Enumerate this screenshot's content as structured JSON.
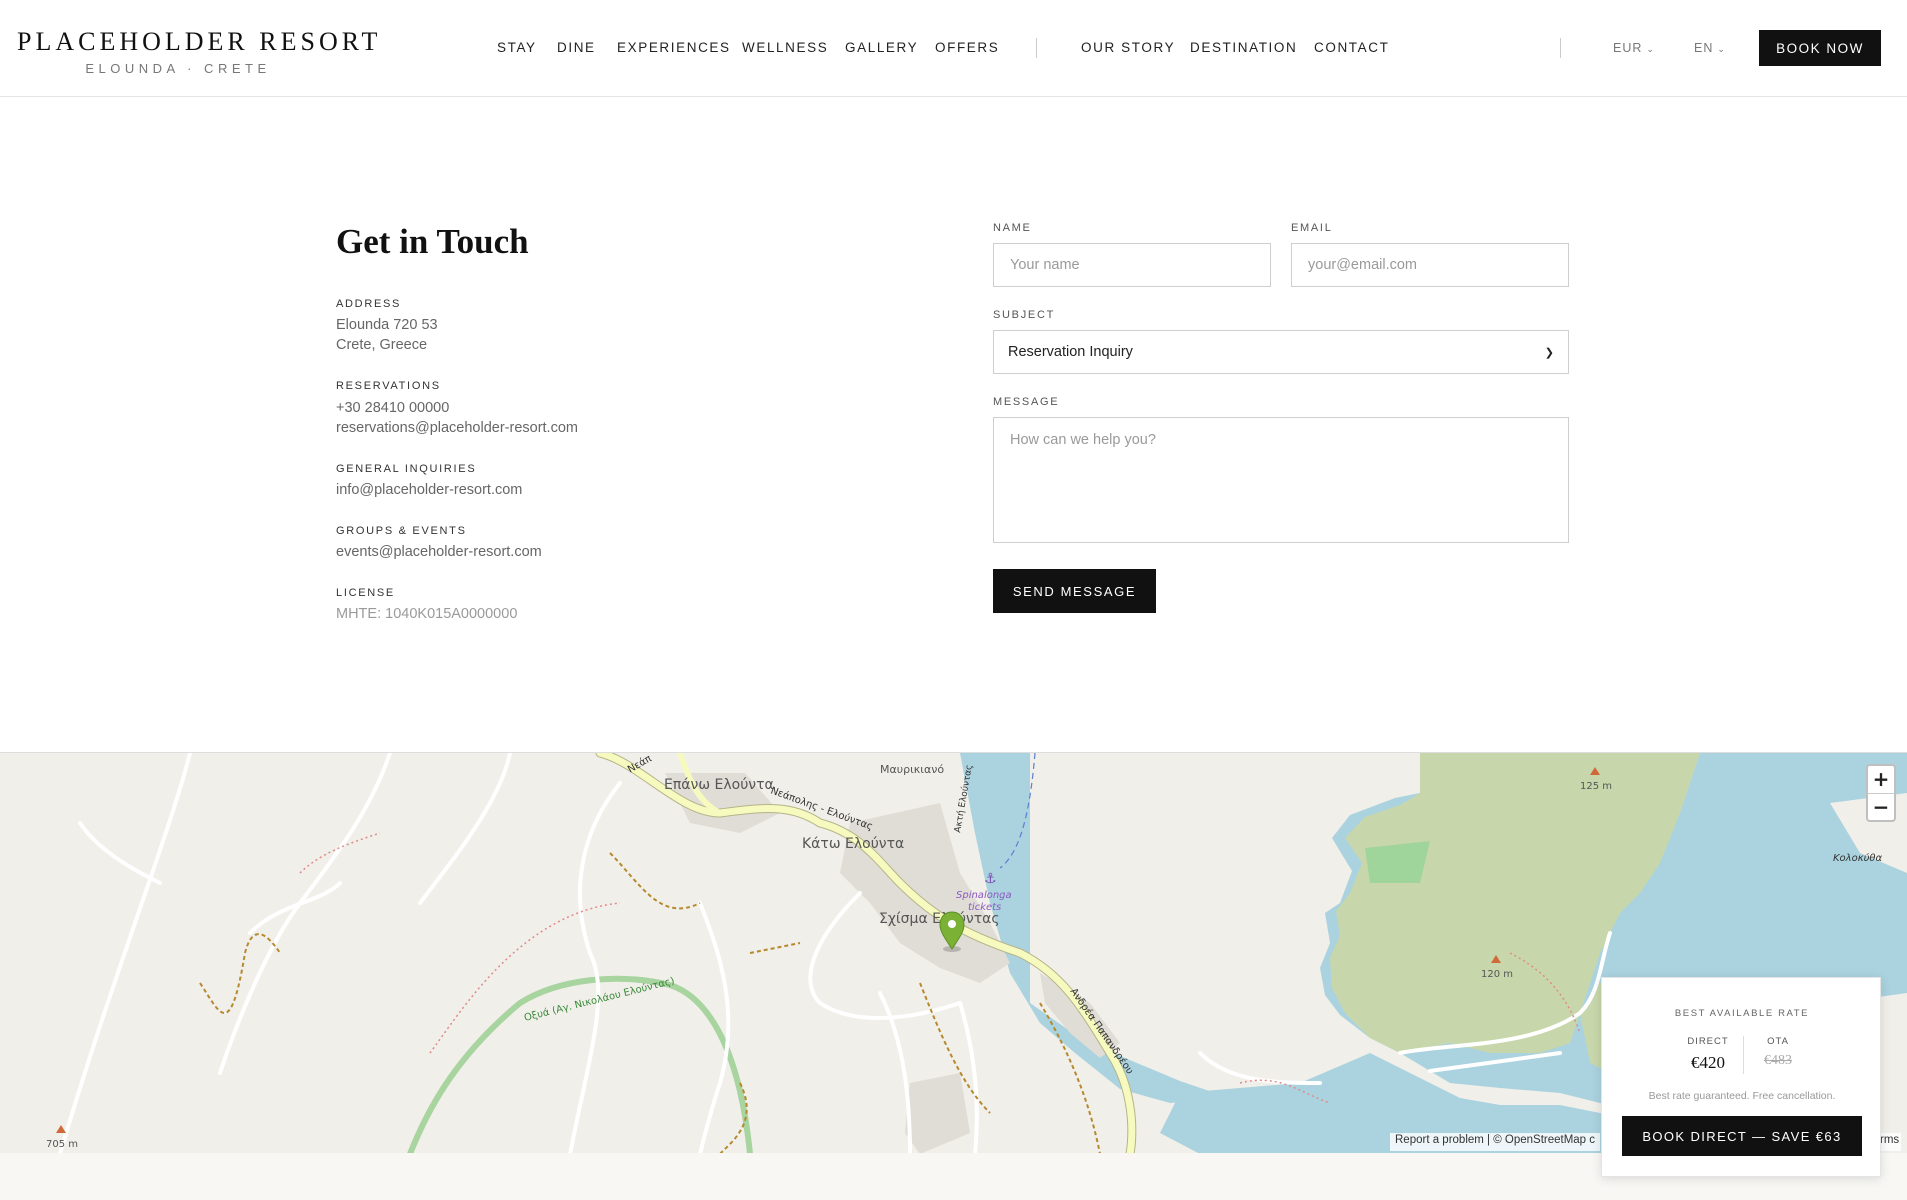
{
  "brand": {
    "name": "PLACEHOLDER RESORT",
    "tagline": "ELOUNDA · CRETE"
  },
  "nav": {
    "primary": [
      "STAY",
      "DINE",
      "EXPERIENCES",
      "WELLNESS",
      "GALLERY",
      "OFFERS"
    ],
    "secondary": [
      "OUR STORY",
      "DESTINATION",
      "CONTACT"
    ],
    "currency": "EUR",
    "language": "EN",
    "book_now": "BOOK NOW"
  },
  "contact": {
    "title": "Get in Touch",
    "address_label": "ADDRESS",
    "address_line1": "Elounda 720 53",
    "address_line2": "Crete, Greece",
    "reservations_label": "RESERVATIONS",
    "reservations_phone": "+30 28410 00000",
    "reservations_email": "reservations@placeholder-resort.com",
    "general_label": "GENERAL INQUIRIES",
    "general_email": "info@placeholder-resort.com",
    "groups_label": "GROUPS & EVENTS",
    "groups_email": "events@placeholder-resort.com",
    "license_label": "LICENSE",
    "license_value": "MHTE: 1040K015A0000000"
  },
  "form": {
    "name_label": "NAME",
    "name_placeholder": "Your name",
    "email_label": "EMAIL",
    "email_placeholder": "your@email.com",
    "subject_label": "SUBJECT",
    "subject_value": "Reservation Inquiry",
    "message_label": "MESSAGE",
    "message_placeholder": "How can we help you?",
    "send_label": "SEND MESSAGE"
  },
  "map": {
    "labels": {
      "epano": "Επάνω Ελούντα",
      "kato": "Κάτω Ελούντα",
      "schisma": "Σχίσμα Ελούντας",
      "mavrikiano": "Μαυρικιανό",
      "spinalonga": "Spinalonga",
      "tickets": "tickets",
      "neapolis_road": "Νεάπολης - Ελούντας",
      "neapolis_top": "Νεάπ",
      "oxya": "Οξυά (Αγ. Νικολάου Ελούντας)",
      "akti": "Ακτή Ελούντας",
      "road_lower": "Ανδρέα Παπανδρέου",
      "kolokytha": "Κολοκύθα",
      "peak_125": "125 m",
      "peak_120": "120 m",
      "peak_705": "705 m"
    },
    "zoom_in": "+",
    "zoom_out": "−",
    "attribution": "Report a problem | © OpenStreetMap c",
    "terms": "rms"
  },
  "rate_widget": {
    "title": "BEST AVAILABLE RATE",
    "direct_label": "DIRECT",
    "direct_price": "€420",
    "ota_label": "OTA",
    "ota_price": "€483",
    "note": "Best rate guaranteed. Free cancellation.",
    "cta": "BOOK DIRECT — SAVE €63"
  },
  "colors": {
    "accent": "#111111",
    "sea": "#aad3df",
    "land": "#f1efe9",
    "forest": "#c8d7ab",
    "road_major": "#f7fabf",
    "marker": "#7bb135"
  }
}
